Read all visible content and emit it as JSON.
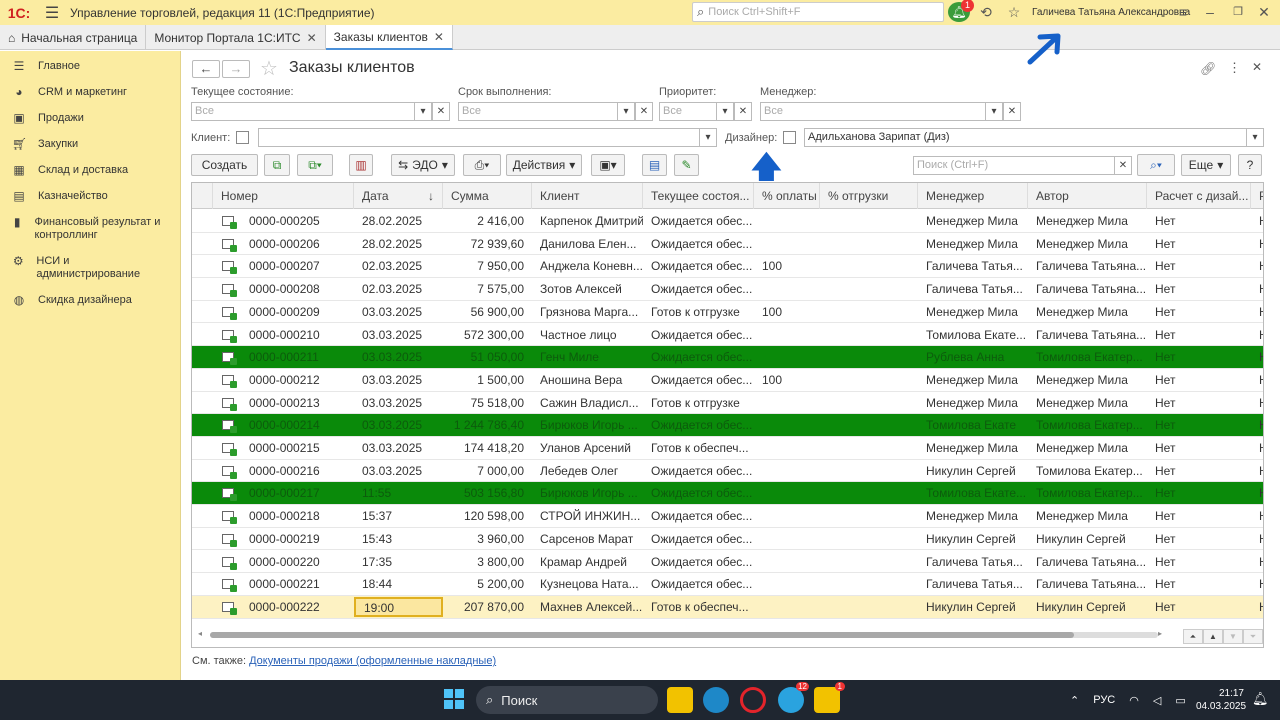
{
  "window": {
    "logo": "1С:",
    "title": "Управление торговлей, редакция 11  (1С:Предприятие)",
    "search_placeholder": "Поиск Ctrl+Shift+F",
    "notifications_count": "1",
    "user": "Галичева Татьяна Александровна"
  },
  "tabs": [
    {
      "label": "Начальная страница"
    },
    {
      "label": "Монитор Портала 1С:ИТС"
    },
    {
      "label": "Заказы клиентов"
    }
  ],
  "sidebar": {
    "items": [
      {
        "label": "Главное",
        "icon": "menu-icon"
      },
      {
        "label": "CRM и маркетинг",
        "icon": "pie-chart-icon"
      },
      {
        "label": "Продажи",
        "icon": "bag-icon"
      },
      {
        "label": "Закупки",
        "icon": "cart-icon"
      },
      {
        "label": "Склад и доставка",
        "icon": "grid-icon"
      },
      {
        "label": "Казначейство",
        "icon": "wallet-icon"
      },
      {
        "label": "Финансовый результат и контроллинг",
        "icon": "bar-chart-icon"
      },
      {
        "label": "НСИ и администрирование",
        "icon": "gear-icon"
      },
      {
        "label": "Скидка дизайнера",
        "icon": "globe-icon"
      }
    ]
  },
  "page": {
    "title": "Заказы клиентов"
  },
  "filters": {
    "state_label": "Текущее состояние:",
    "state_value": "Все",
    "deadline_label": "Срок выполнения:",
    "deadline_value": "Все",
    "priority_label": "Приоритет:",
    "priority_value": "Все",
    "manager_label": "Менеджер:",
    "manager_value": "Все",
    "client_label": "Клиент:",
    "client_value": "",
    "designer_label": "Дизайнер:",
    "designer_value": "Адильханова Зарипат (Диз)"
  },
  "toolbar": {
    "create": "Создать",
    "edo": "ЭДО",
    "actions": "Действия",
    "search_placeholder": "Поиск (Ctrl+F)",
    "more": "Еще",
    "help": "?"
  },
  "table": {
    "columns": [
      "Номер",
      "Дата",
      "Сумма",
      "Клиент",
      "Текущее состоя...",
      "% оплаты",
      "% отгрузки",
      "Менеджер",
      "Автор",
      "Расчет с дизай...",
      "Р"
    ],
    "rows": [
      {
        "num": "0000-000205",
        "date": "28.02.2025",
        "sum": "2 416,00",
        "client": "Карпенок Дмитрий",
        "state": "Ожидается обес...",
        "pay": "",
        "ship": "",
        "manager": "Менеджер Мила",
        "author": "Менеджер Мила",
        "calc": "Нет",
        "r": "Н",
        "style": ""
      },
      {
        "num": "0000-000206",
        "date": "28.02.2025",
        "sum": "72 939,60",
        "client": "Данилова Елен...",
        "state": "Ожидается обес...",
        "pay": "",
        "ship": "",
        "manager": "Менеджер Мила",
        "author": "Менеджер Мила",
        "calc": "Нет",
        "r": "Н",
        "style": ""
      },
      {
        "num": "0000-000207",
        "date": "02.03.2025",
        "sum": "7 950,00",
        "client": "Анджела Коневн...",
        "state": "Ожидается обес...",
        "pay": "100",
        "ship": "",
        "manager": "Галичева Татья...",
        "author": "Галичева Татьяна...",
        "calc": "Нет",
        "r": "Н",
        "style": ""
      },
      {
        "num": "0000-000208",
        "date": "02.03.2025",
        "sum": "7 575,00",
        "client": "Зотов Алексей",
        "state": "Ожидается обес...",
        "pay": "",
        "ship": "",
        "manager": "Галичева Татья...",
        "author": "Галичева Татьяна...",
        "calc": "Нет",
        "r": "Н",
        "style": ""
      },
      {
        "num": "0000-000209",
        "date": "03.03.2025",
        "sum": "56 900,00",
        "client": "Грязнова Марга...",
        "state": "Готов к отгрузке",
        "pay": "100",
        "ship": "",
        "manager": "Менеджер Мила",
        "author": "Менеджер Мила",
        "calc": "Нет",
        "r": "Н",
        "style": ""
      },
      {
        "num": "0000-000210",
        "date": "03.03.2025",
        "sum": "572 300,00",
        "client": "Частное лицо",
        "state": "Ожидается обес...",
        "pay": "",
        "ship": "",
        "manager": "Томилова Екате...",
        "author": "Галичева Татьяна...",
        "calc": "Нет",
        "r": "Н",
        "style": ""
      },
      {
        "num": "0000-000211",
        "date": "03.03.2025",
        "sum": "51 050,00",
        "client": "Генч Миле",
        "state": "Ожидается обес...",
        "pay": "",
        "ship": "",
        "manager": "Рублева Анна",
        "author": "Томилова Екатер...",
        "calc": "Нет",
        "r": "Н",
        "style": "green"
      },
      {
        "num": "0000-000212",
        "date": "03.03.2025",
        "sum": "1 500,00",
        "client": "Аношина Вера",
        "state": "Ожидается обес...",
        "pay": "100",
        "ship": "",
        "manager": "Менеджер Мила",
        "author": "Менеджер Мила",
        "calc": "Нет",
        "r": "Н",
        "style": ""
      },
      {
        "num": "0000-000213",
        "date": "03.03.2025",
        "sum": "75 518,00",
        "client": "Сажин Владисл...",
        "state": "Готов к отгрузке",
        "pay": "",
        "ship": "",
        "manager": "Менеджер Мила",
        "author": "Менеджер Мила",
        "calc": "Нет",
        "r": "Н",
        "style": ""
      },
      {
        "num": "0000-000214",
        "date": "03.03.2025",
        "sum": "1 244 786,40",
        "client": "Бирюков Игорь ...",
        "state": "Ожидается обес...",
        "pay": "",
        "ship": "",
        "manager": "Томилова Екате",
        "author": "Томилова Екатер...",
        "calc": "Нет",
        "r": "Н",
        "style": "green"
      },
      {
        "num": "0000-000215",
        "date": "03.03.2025",
        "sum": "174 418,20",
        "client": "Уланов Арсений",
        "state": "Готов к обеспеч...",
        "pay": "",
        "ship": "",
        "manager": "Менеджер Мила",
        "author": "Менеджер Мила",
        "calc": "Нет",
        "r": "Н",
        "style": ""
      },
      {
        "num": "0000-000216",
        "date": "03.03.2025",
        "sum": "7 000,00",
        "client": "Лебедев Олег",
        "state": "Ожидается обес...",
        "pay": "",
        "ship": "",
        "manager": "Никулин Сергей",
        "author": "Томилова Екатер...",
        "calc": "Нет",
        "r": "Н",
        "style": ""
      },
      {
        "num": "0000-000217",
        "date": "11:55",
        "sum": "503 156,80",
        "client": "Бирюков Игорь ...",
        "state": "Ожидается обес...",
        "pay": "",
        "ship": "",
        "manager": "Томилова Екате...",
        "author": "Томилова Екатер...",
        "calc": "Нет",
        "r": "Н",
        "style": "green"
      },
      {
        "num": "0000-000218",
        "date": "15:37",
        "sum": "120 598,00",
        "client": "СТРОЙ ИНЖИН...",
        "state": "Ожидается обес...",
        "pay": "",
        "ship": "",
        "manager": "Менеджер Мила",
        "author": "Менеджер Мила",
        "calc": "Нет",
        "r": "Н",
        "style": ""
      },
      {
        "num": "0000-000219",
        "date": "15:43",
        "sum": "3 960,00",
        "client": "Сарсенов Марат",
        "state": "Ожидается обес...",
        "pay": "",
        "ship": "",
        "manager": "Никулин Сергей",
        "author": "Никулин Сергей",
        "calc": "Нет",
        "r": "Н",
        "style": ""
      },
      {
        "num": "0000-000220",
        "date": "17:35",
        "sum": "3 800,00",
        "client": "Крамар Андрей",
        "state": "Ожидается обес...",
        "pay": "",
        "ship": "",
        "manager": "Галичева Татья...",
        "author": "Галичева Татьяна...",
        "calc": "Нет",
        "r": "Н",
        "style": ""
      },
      {
        "num": "0000-000221",
        "date": "18:44",
        "sum": "5 200,00",
        "client": "Кузнецова Ната...",
        "state": "Ожидается обес...",
        "pay": "",
        "ship": "",
        "manager": "Галичева Татья...",
        "author": "Галичева Татьяна...",
        "calc": "Нет",
        "r": "Н",
        "style": ""
      },
      {
        "num": "0000-000222",
        "date": "19:00",
        "sum": "207 870,00",
        "client": "Махнев Алексей...",
        "state": "Готов к обеспеч...",
        "pay": "",
        "ship": "",
        "manager": "Никулин Сергей",
        "author": "Никулин Сергей",
        "calc": "Нет",
        "r": "Н",
        "style": "sel"
      }
    ]
  },
  "see_also": {
    "label": "См. также:",
    "link": "Документы продажи (оформленные накладные)"
  },
  "taskbar": {
    "search": "Поиск",
    "lang": "РУС",
    "time": "21:17",
    "date": "04.03.2025",
    "telegram_badge": "12",
    "onec_badge": "1"
  },
  "colors": {
    "titlebar": "#fbeca1",
    "sidebar": "#fbeca1",
    "highlight_row": "#0a8a0a",
    "selected_row": "#fdf2c3",
    "annotation_arrow": "#1560c9"
  }
}
